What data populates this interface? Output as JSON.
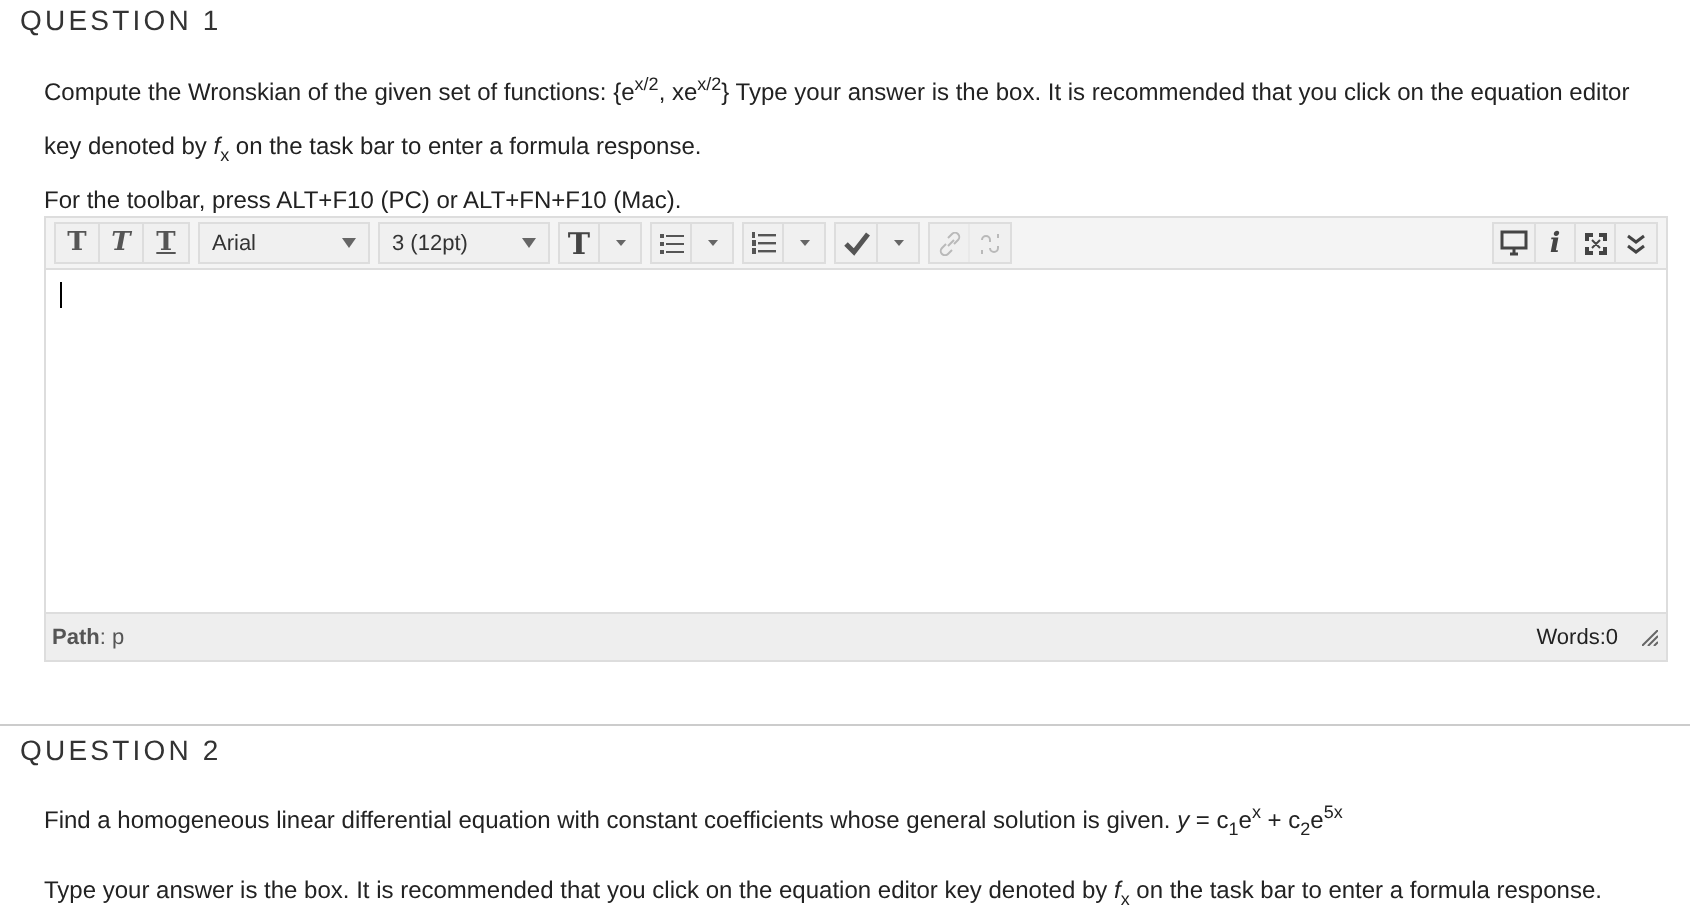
{
  "questions": [
    {
      "title": "QUESTION 1",
      "paragraphs": [
        "Compute the Wronskian of the given set of functions: {e$^{x/2}$, xe$^{x/2}$} Type your answer is the box.  It is recommended that you click on the equation editor key denoted by *f*$_{x}$ on the task bar to enter a formula response.",
        "For the toolbar, press ALT+F10 (PC) or ALT+FN+F10 (Mac)."
      ],
      "editor": {
        "format_buttons": [
          {
            "label": "T",
            "kind": "bold"
          },
          {
            "label": "T",
            "kind": "italic"
          },
          {
            "label": "T",
            "kind": "underline"
          }
        ],
        "font": "Arial",
        "size": "3 (12pt)",
        "color_button": "T",
        "link_disabled": true,
        "info_button": "i",
        "path": "**Path**: p",
        "word_count": "Words:0"
      }
    },
    {
      "title": "QUESTION 2",
      "paragraphs": [
        "Find a homogeneous linear differential equation with constant coefficients whose general solution is given.  *y* = c$_{1}$e$^{x}$ + c$_{2}$e$^{5x}$",
        "Type your answer is the box.  It is recommended that you click on the equation editor key denoted by *f*$_{x}$ on the task bar to enter a formula response."
      ]
    }
  ]
}
